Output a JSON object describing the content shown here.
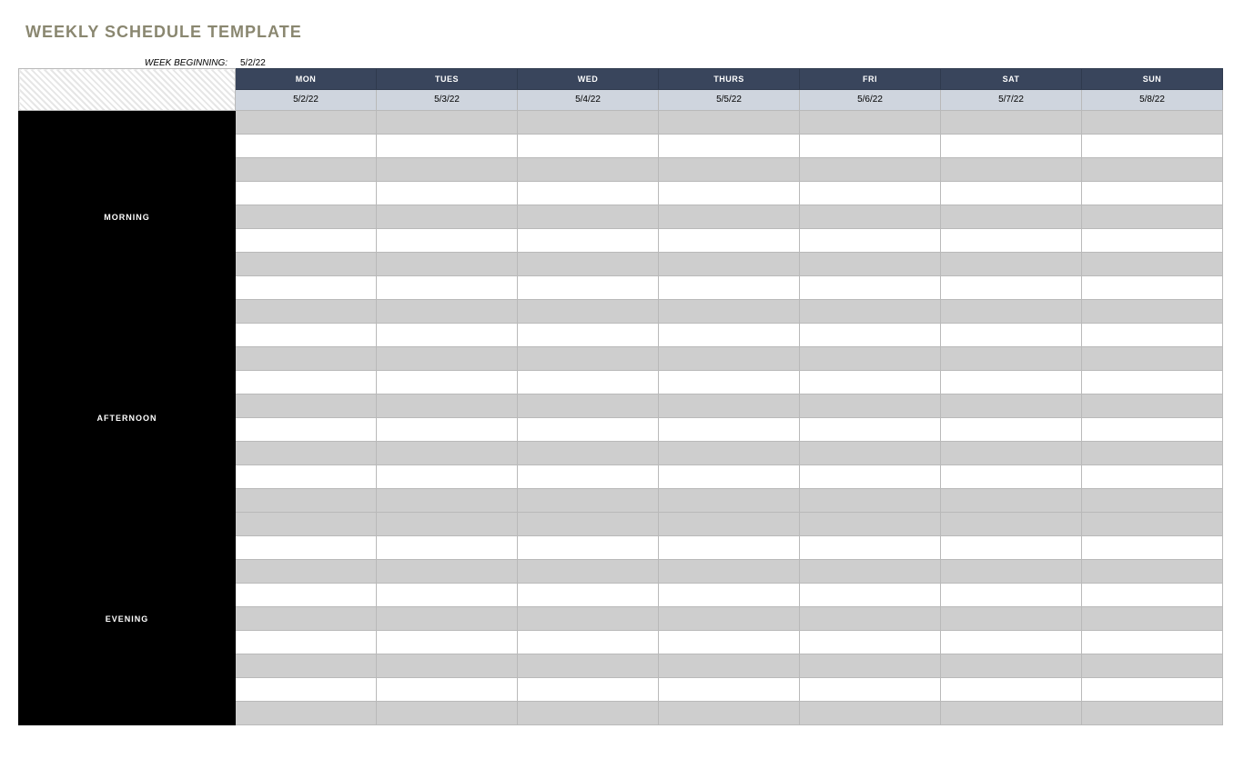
{
  "title": "WEEKLY SCHEDULE TEMPLATE",
  "week_beginning_label": "WEEK BEGINNING:",
  "week_beginning_value": "5/2/22",
  "days": [
    {
      "label": "MON",
      "date": "5/2/22"
    },
    {
      "label": "TUES",
      "date": "5/3/22"
    },
    {
      "label": "WED",
      "date": "5/4/22"
    },
    {
      "label": "THURS",
      "date": "5/5/22"
    },
    {
      "label": "FRI",
      "date": "5/6/22"
    },
    {
      "label": "SAT",
      "date": "5/7/22"
    },
    {
      "label": "SUN",
      "date": "5/8/22"
    }
  ],
  "periods": [
    {
      "label": "MORNING",
      "rows": 9
    },
    {
      "label": "AFTERNOON",
      "rows": 8
    },
    {
      "label": "EVENING",
      "rows": 9
    }
  ]
}
